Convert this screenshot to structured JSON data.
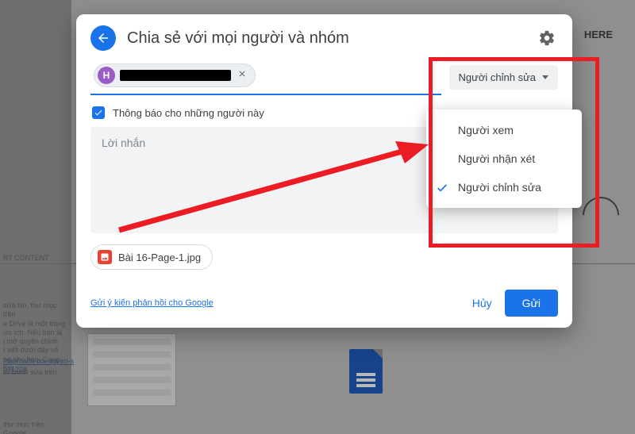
{
  "bg": {
    "here": "HERE",
    "rt": "RT CONTENT",
    "p1": "sửa file, thư mục trên\ne Drive là một trong\nưu ích. Nếu bạn là\nị mở quyền chỉnh\nì viết dưới đây sẽ\nng cho bạn. Cùng tìm",
    "link1": "/dap/cach-doi-quyen-s\n031228",
    "link2": "m chỉnh sửa trên",
    "p3": "thư mục trên Google"
  },
  "dialog": {
    "title": "Chia sẻ với mọi người và nhóm",
    "chip_initial": "H",
    "perm_selected": "Người chỉnh sửa",
    "notify_label": "Thông báo cho những người này",
    "message_placeholder": "Lời nhắn",
    "attachment": "Bài 16-Page-1.jpg",
    "feedback": "Gửi ý kiến phản hồi cho Google",
    "cancel": "Hủy",
    "send": "Gửi"
  },
  "perm_menu": {
    "viewer": "Người xem",
    "commenter": "Người nhận xét",
    "editor": "Người chỉnh sửa"
  }
}
